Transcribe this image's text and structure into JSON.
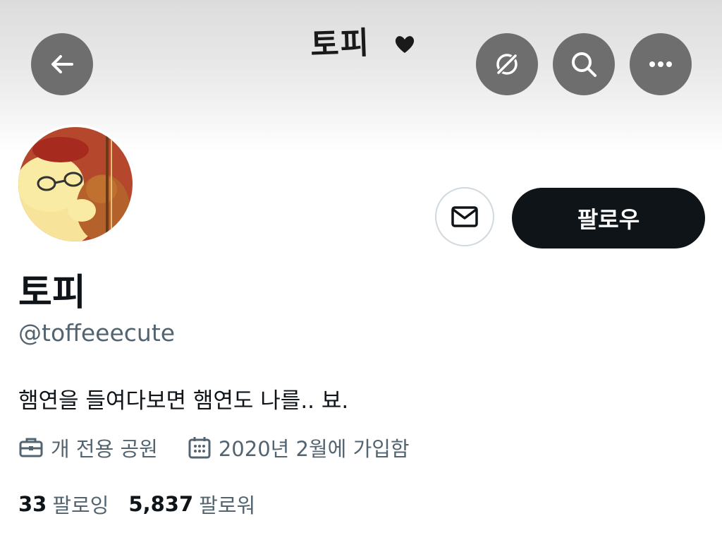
{
  "header": {
    "banner_text": "토피",
    "banner_heart": "heart-doodle",
    "buttons": {
      "back": "back-arrow-icon",
      "grok": "grok-icon",
      "search": "search-icon",
      "more": "more-dots-icon"
    }
  },
  "profile": {
    "display_name": "토피",
    "handle": "@toffeeecute",
    "bio": "햄연을 들여다보면 햄연도 나를.. 뵤.",
    "category": "개 전용 공원",
    "joined": "2020년 2월에 가입함",
    "following_count": "33",
    "following_label": "팔로잉",
    "followers_count": "5,837",
    "followers_label": "팔로워"
  },
  "actions": {
    "follow_label": "팔로우",
    "message_icon": "envelope-icon"
  },
  "colors": {
    "primary_text": "#0f1419",
    "secondary_text": "#536471",
    "follow_button_bg": "#0f1419",
    "header_button_bg": "#6e6e6e",
    "border": "#cfd9de"
  }
}
